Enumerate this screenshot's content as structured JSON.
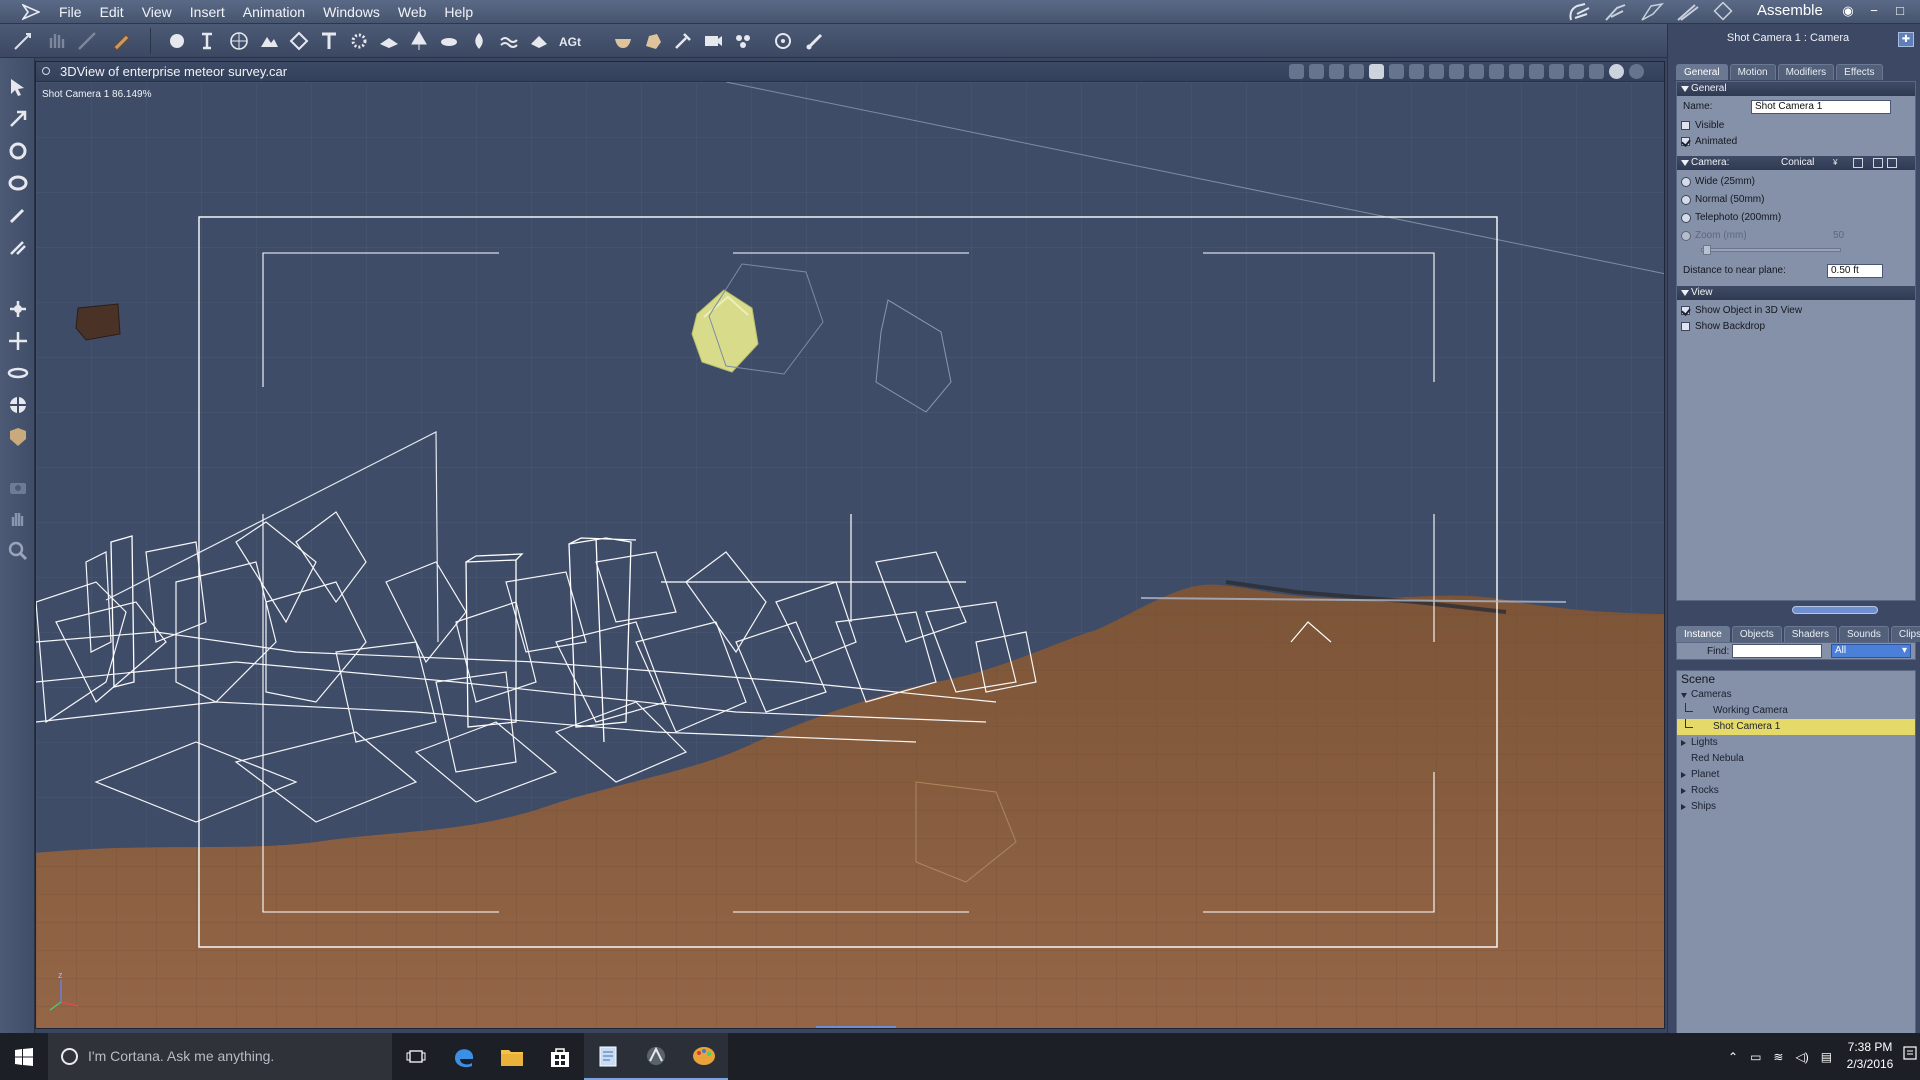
{
  "app": {
    "menus": [
      "File",
      "Edit",
      "View",
      "Insert",
      "Animation",
      "Windows",
      "Web",
      "Help"
    ],
    "room_label": "Assemble",
    "room_icons": [
      "hand-room-icon",
      "face-room-icon",
      "hair-room-icon",
      "cloth-room-icon",
      "material-room-icon"
    ],
    "window_controls": [
      "eye-icon",
      "minimize-icon",
      "maximize-icon",
      "close-icon"
    ]
  },
  "viewport": {
    "title": "3DView of enterprise meteor survey.car",
    "camera_label": "Shot Camera 1 86.149%"
  },
  "properties": {
    "title": "Shot Camera 1 : Camera",
    "tabs": [
      {
        "label": "General",
        "active": true
      },
      {
        "label": "Motion",
        "active": false
      },
      {
        "label": "Modifiers",
        "active": false
      },
      {
        "label": "Effects",
        "active": false
      }
    ],
    "general": {
      "section": "General",
      "name_label": "Name:",
      "name_value": "Shot Camera 1",
      "visible_label": "Visible",
      "visible": false,
      "animated_label": "Animated",
      "animated": true
    },
    "camera": {
      "section": "Camera:",
      "type": "Conical",
      "lenses": [
        "Wide (25mm)",
        "Normal (50mm)",
        "Telephoto (200mm)"
      ],
      "zoom_label": "Zoom (mm)",
      "zoom_value": "50",
      "near_plane_label": "Distance to near plane:",
      "near_plane_value": "0.50 ft"
    },
    "view": {
      "section": "View",
      "show_object_label": "Show Object in 3D View",
      "show_object": true,
      "show_backdrop_label": "Show Backdrop",
      "show_backdrop": false
    }
  },
  "scene_tree": {
    "tabs": [
      {
        "label": "Instance",
        "active": true
      },
      {
        "label": "Objects",
        "active": false
      },
      {
        "label": "Shaders",
        "active": false
      },
      {
        "label": "Sounds",
        "active": false
      },
      {
        "label": "Clips",
        "active": false
      }
    ],
    "find_label": "Find:",
    "find_value": "",
    "filter_value": "All",
    "root": "Scene",
    "items": [
      {
        "label": "Cameras",
        "level": 0,
        "expander": "open",
        "selected": false
      },
      {
        "label": "Working Camera",
        "level": 1,
        "expander": "none",
        "selected": false
      },
      {
        "label": "Shot Camera 1",
        "level": 1,
        "expander": "none",
        "selected": true
      },
      {
        "label": "Lights",
        "level": 0,
        "expander": "closed",
        "selected": false
      },
      {
        "label": "Red Nebula",
        "level": 0,
        "expander": "none",
        "selected": false
      },
      {
        "label": "Planet",
        "level": 0,
        "expander": "closed",
        "selected": false
      },
      {
        "label": "Rocks",
        "level": 0,
        "expander": "closed",
        "selected": false
      },
      {
        "label": "Ships",
        "level": 0,
        "expander": "closed",
        "selected": false
      }
    ]
  },
  "taskbar": {
    "search_placeholder": "I'm Cortana. Ask me anything.",
    "apps": [
      "task-view-icon",
      "edge-icon",
      "file-explorer-icon",
      "store-icon",
      "notepad-icon",
      "carrara-icon",
      "paint-icon"
    ],
    "time": "7:38 PM",
    "date": "2/3/2016"
  },
  "colors": {
    "viewport_bg": "#3e4b66",
    "ground": "#8a5e40",
    "wireframe": "#ffffff",
    "selection": "#e5d96a",
    "planet": "#d8dc8a"
  }
}
